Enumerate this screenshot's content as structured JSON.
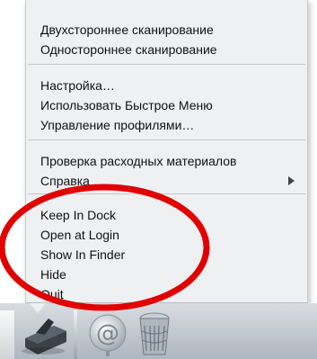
{
  "menu": {
    "group1": [
      "Двухстороннее сканирование",
      "Одностороннее сканирование"
    ],
    "group2": [
      "Настройка…",
      "Использовать Быстрое Меню",
      "Управление профилями…"
    ],
    "group3": [
      "Проверка расходных материалов",
      "Справка"
    ],
    "group4": [
      "Keep In Dock",
      "Open at Login",
      "Show In Finder",
      "Hide",
      "Quit"
    ]
  },
  "icons": {
    "submenu_arrow": "submenu-arrow-icon",
    "scanner": "scanner-icon",
    "mail": "mail-at-icon",
    "trash": "trash-icon"
  },
  "colors": {
    "annotation_ring": "#e00000",
    "menu_background": "#eef0f2"
  }
}
